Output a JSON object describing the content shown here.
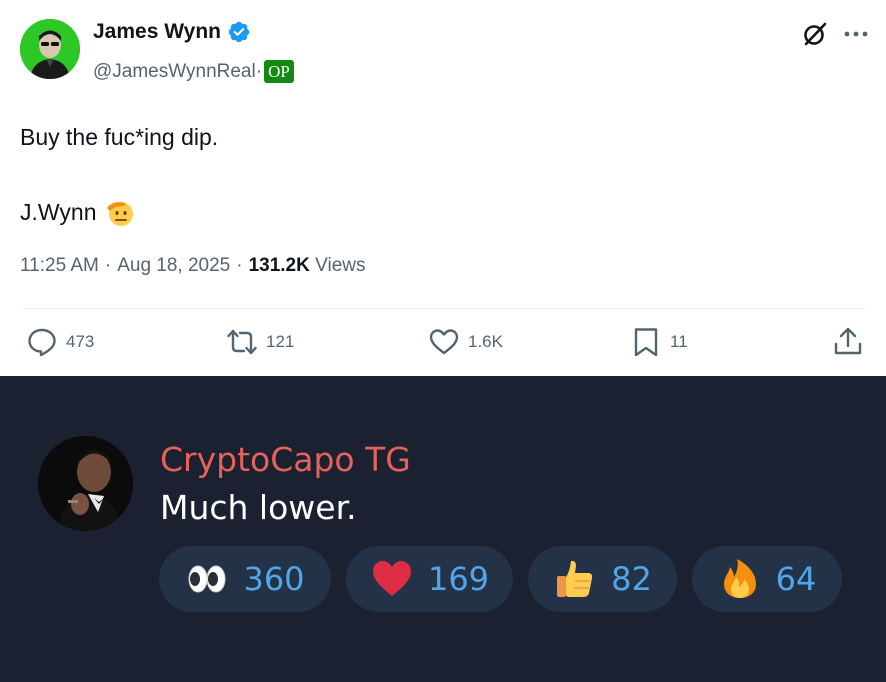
{
  "tweet": {
    "author": {
      "display_name": "James Wynn",
      "handle": "@JamesWynnReal",
      "handle_separator": "·",
      "badge": "OP",
      "verified": true,
      "avatar_icon": "avatar-man-sunglasses"
    },
    "text_line1": "Buy the fuc*ing dip.",
    "text_line2": "J.Wynn",
    "signature_emoji": "saluting-face",
    "time": "11:25 AM",
    "date": "Aug 18, 2025",
    "views_count": "131.2K",
    "views_label": "Views",
    "actions": {
      "reply_count": "473",
      "retweet_count": "121",
      "like_count": "1.6K",
      "bookmark_count": "11"
    }
  },
  "telegram": {
    "sender_name": "CryptoCapo TG",
    "message": "Much lower.",
    "sender_color": "#e5625b",
    "reactions": [
      {
        "emoji": "eyes",
        "count": "360"
      },
      {
        "emoji": "red-heart",
        "count": "169"
      },
      {
        "emoji": "thumbs-up",
        "count": "82"
      },
      {
        "emoji": "fire",
        "count": "64"
      }
    ]
  },
  "colors": {
    "verified_blue": "#1d9bf0",
    "op_green": "#128a12",
    "reaction_count_blue": "#4fa6ea",
    "telegram_bg": "#1b2130"
  }
}
